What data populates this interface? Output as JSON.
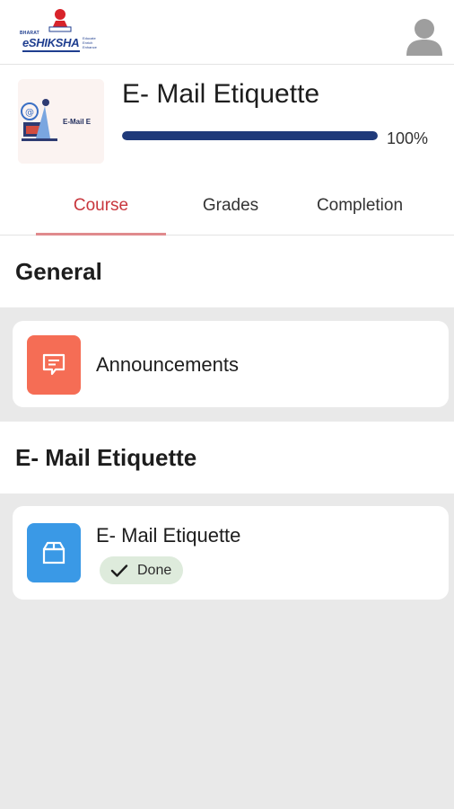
{
  "header": {
    "logo": {
      "small_text": "BHARAT",
      "brand": "eSHIKSHA",
      "tagline": "Educate Enrich Enhance"
    },
    "avatar_icon": "user-avatar-icon"
  },
  "course": {
    "thumbnail_text": "E-Mail E",
    "title": "E- Mail Etiquette",
    "progress_percent": 100,
    "progress_label": "100%"
  },
  "tabs": [
    {
      "label": "Course",
      "active": true
    },
    {
      "label": "Grades",
      "active": false
    },
    {
      "label": "Completion",
      "active": false
    }
  ],
  "sections": [
    {
      "title": "General",
      "modules": [
        {
          "label": "Announcements",
          "icon": "announcement-icon",
          "icon_color": "#f56d55"
        }
      ]
    },
    {
      "title": "E- Mail Etiquette",
      "modules": [
        {
          "label": "E- Mail Etiquette",
          "icon": "package-icon",
          "icon_color": "#3a99e6",
          "status": "Done"
        }
      ]
    }
  ],
  "colors": {
    "accent": "#c8363d",
    "progress": "#1f3a7a",
    "brand": "#1f3e8f",
    "done_badge_bg": "#deebdc"
  }
}
